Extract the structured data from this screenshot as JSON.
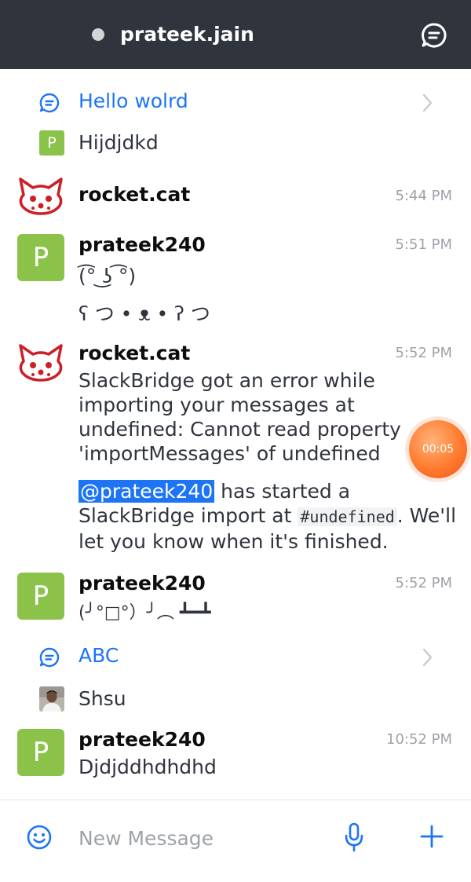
{
  "header": {
    "room_name": "prateek.jain",
    "status": "offline",
    "colors": {
      "bar": "#2f343d",
      "status_dot": "#d2d4d6"
    },
    "thread_icon": "threads-icon"
  },
  "messages": [
    {
      "kind": "thread",
      "title": "Hello wolrd",
      "reply_author_initial": "P",
      "reply_text": "Hijdjdkd"
    },
    {
      "kind": "message",
      "user": "rocket.cat",
      "time": "5:44 PM",
      "avatar": "rocket-cat-avatar",
      "lines": []
    },
    {
      "kind": "message",
      "user": "prateek240",
      "time": "5:51 PM",
      "avatar_initial": "P",
      "lines": [
        "(͡° ͜ʖ ͡°)",
        "ʕ つ • ᴥ • ʔ つ"
      ]
    },
    {
      "kind": "message",
      "user": "rocket.cat",
      "time": "5:52 PM",
      "avatar": "rocket-cat-avatar",
      "error_text": "SlackBridge got an error while importing your messages at undefined: Cannot read property 'importMessages' of undefined",
      "mention": "@prateek240",
      "import_text_1": " has started a SlackBridge import at ",
      "channel_code": "#undefined",
      "import_text_2": ". We'll let you know when it's finished."
    },
    {
      "kind": "message",
      "user": "prateek240",
      "time": "5:52 PM",
      "avatar_initial": "P",
      "lines": [
        "(╯°□°）╯︵ ┻━┻"
      ]
    },
    {
      "kind": "thread",
      "title": "ABC",
      "reply_author": "photo-avatar",
      "reply_text": "Shsu"
    },
    {
      "kind": "message",
      "user": "prateek240",
      "time": "10:52 PM",
      "avatar_initial": "P",
      "lines": [
        "Djdjddhdhdhd"
      ]
    }
  ],
  "recording_timer": "00:05",
  "composer": {
    "placeholder": "New Message",
    "emoji_icon": "emoji-icon",
    "mic_icon": "microphone-icon",
    "plus_icon": "plus-icon"
  },
  "colors": {
    "accent": "#1d74f5",
    "avatar_green": "#8bc34a",
    "timestamp": "#9ea2a8",
    "timer": "#ff7b2e"
  }
}
